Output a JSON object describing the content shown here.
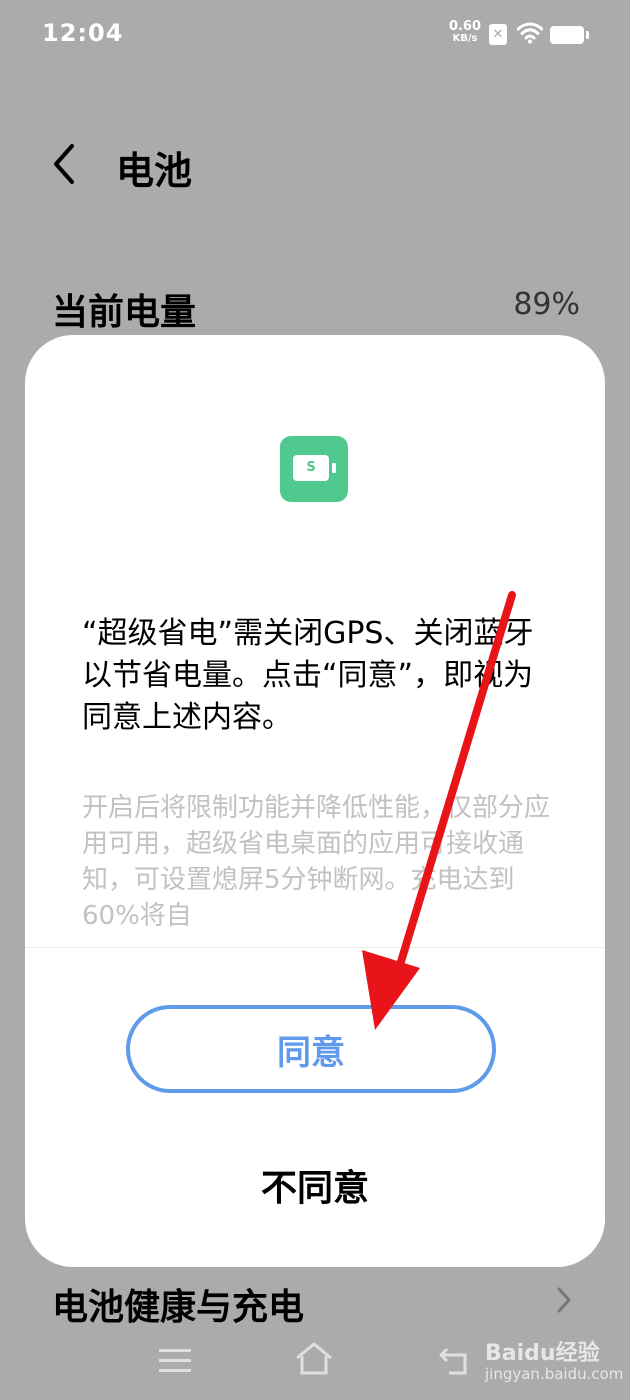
{
  "status_bar": {
    "time": "12:04",
    "net_speed_value": "0.60",
    "net_speed_unit": "KB/s",
    "sim_icon": "x-sim-icon",
    "wifi_icon": "wifi-icon",
    "battery_icon": "battery-icon"
  },
  "header": {
    "title": "电池",
    "back_icon": "chevron-left-icon"
  },
  "rows": {
    "current_label": "当前电量",
    "current_value": "89%",
    "health_label": "电池健康与充电"
  },
  "dialog": {
    "icon_letter": "S",
    "message": "“超级省电”需关闭GPS、关闭蓝牙以节省电量。点击“同意”，即视为同意上述内容。",
    "detail": "开启后将限制功能并降低性能，仅部分应用可用，超级省电桌面的应用可接收通知，可设置熄屏5分钟断网。充电达到60%将自",
    "agree": "同意",
    "disagree": "不同意"
  },
  "nav": {
    "menu_icon": "menu-icon",
    "home_icon": "home-icon",
    "back_icon": "back-icon"
  },
  "watermark": {
    "brand": "Baidu经验",
    "site": "jingyan.baidu.com"
  },
  "colors": {
    "backdrop": "#ababab",
    "accent": "#5f9bea",
    "app_icon": "#4fc98e",
    "arrow": "#e8141a"
  }
}
